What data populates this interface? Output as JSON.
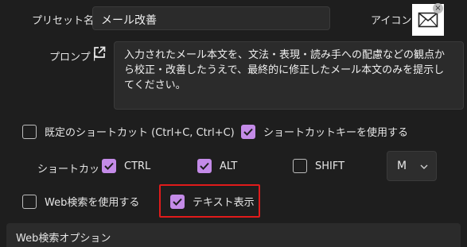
{
  "preset": {
    "label": "プリセット名",
    "value": "メール改善"
  },
  "icon": {
    "label": "アイコン",
    "name": "envelope-icon"
  },
  "prompt": {
    "label": "プロンプト",
    "open_icon": "external-link-icon",
    "text": "入力されたメール本文を、文法・表現・読み手への配慮などの観点から校正・改善したうえで、最終的に修正したメール本文のみを提示してください。"
  },
  "options": {
    "default_shortcut": {
      "label": "既定のショートカット (Ctrl+C, Ctrl+C)",
      "checked": false
    },
    "use_shortcut_key": {
      "label": "ショートカットキーを使用する",
      "checked": true
    }
  },
  "shortcut": {
    "label": "ショートカット",
    "ctrl": {
      "label": "CTRL",
      "checked": true
    },
    "alt": {
      "label": "ALT",
      "checked": true
    },
    "shift": {
      "label": "SHIFT",
      "checked": false
    },
    "key": {
      "value": "M"
    }
  },
  "web_search": {
    "label": "Web検索を使用する",
    "checked": false
  },
  "text_display": {
    "label": "テキスト表示",
    "checked": true
  },
  "section": {
    "label": "Web検索オプション"
  },
  "colors": {
    "accent": "#c48be8",
    "highlight": "#e01b1b",
    "background": "#1e1e1e"
  }
}
